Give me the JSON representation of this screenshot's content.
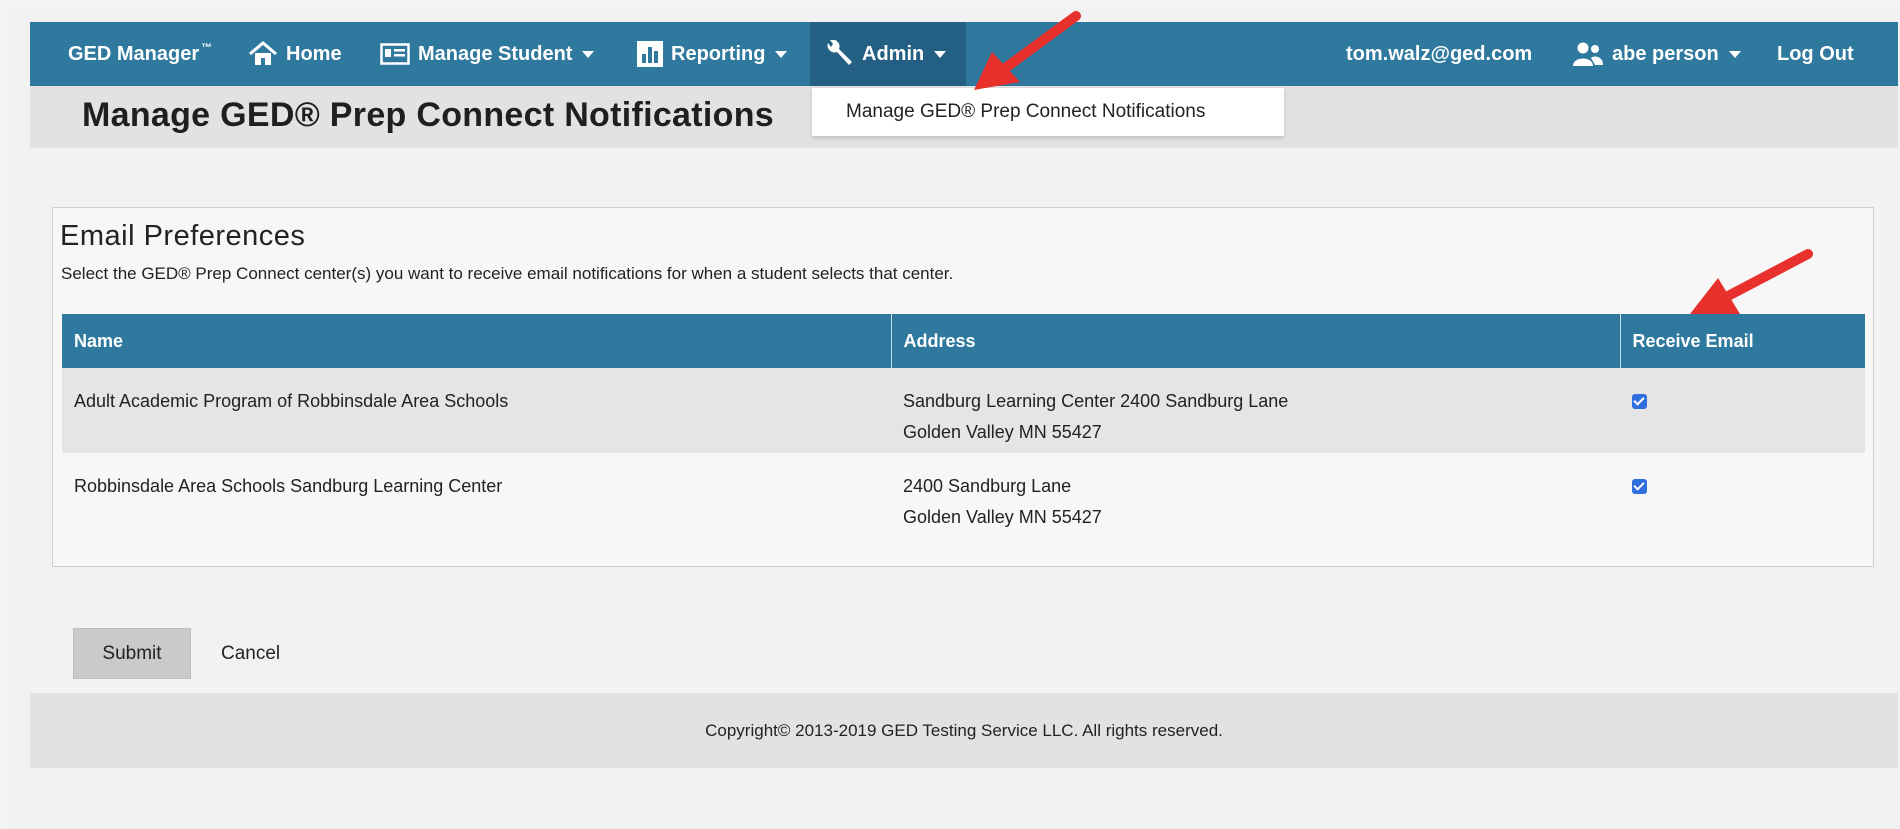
{
  "nav": {
    "brand": "GED Manager",
    "brand_tm": "™",
    "home": "Home",
    "manage_student": "Manage Student",
    "reporting": "Reporting",
    "admin": "Admin",
    "user_email": "tom.walz@ged.com",
    "role": "abe person",
    "logout": "Log Out"
  },
  "admin_menu": {
    "items": [
      "Manage GED® Prep Connect Notifications"
    ]
  },
  "page": {
    "title": "Manage GED® Prep Connect Notifications"
  },
  "preferences": {
    "title": "Email Preferences",
    "description": "Select the GED® Prep Connect center(s) you want to receive email notifications for when a student selects that center.",
    "columns": [
      "Name",
      "Address",
      "Receive Email"
    ],
    "rows": [
      {
        "name": "Adult Academic Program of Robbinsdale Area Schools",
        "address_line1": "Sandburg Learning Center 2400 Sandburg Lane",
        "address_line2": "Golden Valley MN 55427",
        "receive_email": true
      },
      {
        "name": "Robbinsdale Area Schools Sandburg Learning Center",
        "address_line1": "2400 Sandburg Lane",
        "address_line2": "Golden Valley MN 55427",
        "receive_email": true
      }
    ]
  },
  "actions": {
    "submit": "Submit",
    "cancel": "Cancel"
  },
  "footer": {
    "copyright": "Copyright© 2013-2019 GED Testing Service LLC. All rights reserved."
  },
  "colors": {
    "nav_bg": "#2f789e",
    "nav_active": "#236083",
    "annotation_arrow": "#e8302c",
    "checkbox": "#2f6fe0"
  }
}
